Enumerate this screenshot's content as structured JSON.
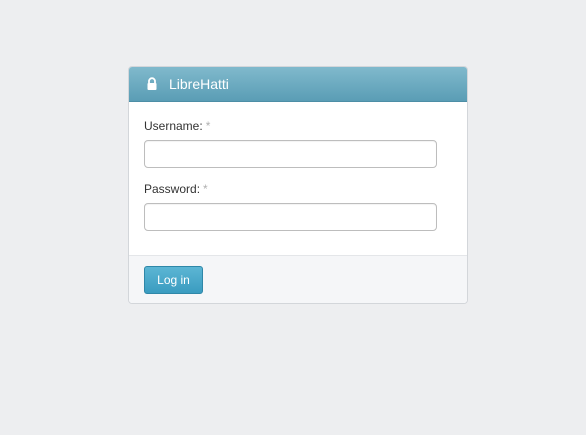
{
  "panel": {
    "title": "LibreHatti",
    "icon": "lock-icon"
  },
  "form": {
    "username_label": "Username:",
    "username_required": "*",
    "username_value": "",
    "password_label": "Password:",
    "password_required": "*",
    "password_value": ""
  },
  "footer": {
    "login_label": "Log in"
  },
  "colors": {
    "background": "#edeef0",
    "header": "#5a9db5",
    "button": "#3a9cc0"
  }
}
